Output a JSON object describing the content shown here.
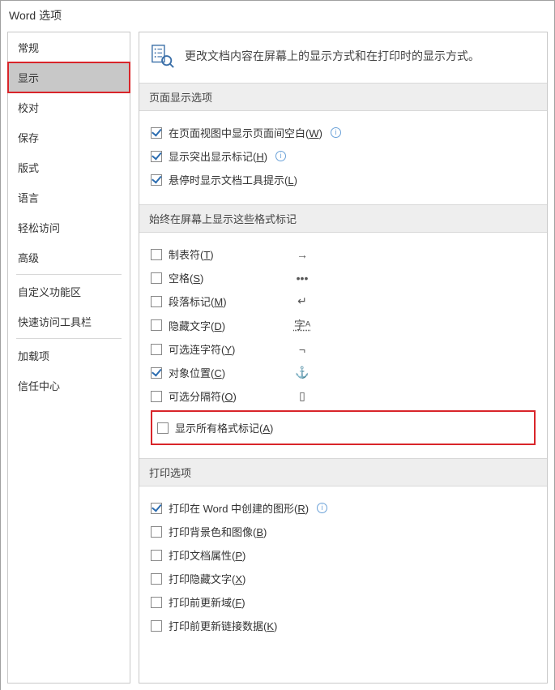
{
  "window": {
    "title": "Word 选项"
  },
  "sidebar": {
    "items": [
      {
        "label": "常规"
      },
      {
        "label": "显示"
      },
      {
        "label": "校对"
      },
      {
        "label": "保存"
      },
      {
        "label": "版式"
      },
      {
        "label": "语言"
      },
      {
        "label": "轻松访问"
      },
      {
        "label": "高级"
      },
      {
        "label": "自定义功能区"
      },
      {
        "label": "快速访问工具栏"
      },
      {
        "label": "加载项"
      },
      {
        "label": "信任中心"
      }
    ]
  },
  "header": {
    "description": "更改文档内容在屏幕上的显示方式和在打印时的显示方式。"
  },
  "section_page": {
    "title": "页面显示选项",
    "opts": [
      {
        "label_pre": "在页面视图中显示页面间空白(",
        "key": "W",
        "label_post": ")",
        "checked": true,
        "info": true
      },
      {
        "label_pre": "显示突出显示标记(",
        "key": "H",
        "label_post": ")",
        "checked": true,
        "info": true
      },
      {
        "label_pre": "悬停时显示文档工具提示(",
        "key": "L",
        "label_post": ")",
        "checked": true,
        "info": false
      }
    ]
  },
  "section_marks": {
    "title": "始终在屏幕上显示这些格式标记",
    "opts": [
      {
        "label_pre": "制表符(",
        "key": "T",
        "label_post": ")",
        "checked": false,
        "symbol": "→"
      },
      {
        "label_pre": "空格(",
        "key": "S",
        "label_post": ")",
        "checked": false,
        "symbol": "•••"
      },
      {
        "label_pre": "段落标记(",
        "key": "M",
        "label_post": ")",
        "checked": false,
        "symbol": "↵"
      },
      {
        "label_pre": "隐藏文字(",
        "key": "D",
        "label_post": ")",
        "checked": false,
        "symbol": "字ᴬ"
      },
      {
        "label_pre": "可选连字符(",
        "key": "Y",
        "label_post": ")",
        "checked": false,
        "symbol": "¬"
      },
      {
        "label_pre": "对象位置(",
        "key": "C",
        "label_post": ")",
        "checked": true,
        "symbol": "⚓"
      },
      {
        "label_pre": "可选分隔符(",
        "key": "O",
        "label_post": ")",
        "checked": false,
        "symbol": "▯"
      }
    ],
    "all_marks": {
      "label_pre": "显示所有格式标记(",
      "key": "A",
      "label_post": ")",
      "checked": false
    }
  },
  "section_print": {
    "title": "打印选项",
    "opts": [
      {
        "label_pre": "打印在 Word 中创建的图形(",
        "key": "R",
        "label_post": ")",
        "checked": true,
        "info": true
      },
      {
        "label_pre": "打印背景色和图像(",
        "key": "B",
        "label_post": ")",
        "checked": false,
        "info": false
      },
      {
        "label_pre": "打印文档属性(",
        "key": "P",
        "label_post": ")",
        "checked": false,
        "info": false
      },
      {
        "label_pre": "打印隐藏文字(",
        "key": "X",
        "label_post": ")",
        "checked": false,
        "info": false
      },
      {
        "label_pre": "打印前更新域(",
        "key": "F",
        "label_post": ")",
        "checked": false,
        "info": false
      },
      {
        "label_pre": "打印前更新链接数据(",
        "key": "K",
        "label_post": ")",
        "checked": false,
        "info": false
      }
    ]
  }
}
